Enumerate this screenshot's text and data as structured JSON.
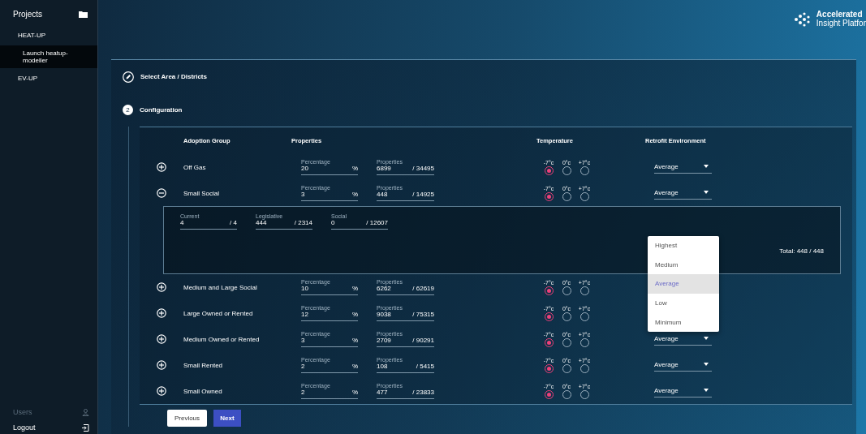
{
  "sidebar": {
    "title": "Projects",
    "items": [
      {
        "label": "HEAT-UP",
        "selected": false,
        "children": [
          {
            "label": "Launch heatup-modeller",
            "selected": true
          }
        ]
      },
      {
        "label": "EV-UP",
        "selected": false
      }
    ],
    "footer": [
      {
        "label": "Users",
        "disabled": true,
        "kind": "users"
      },
      {
        "label": "Logout",
        "disabled": false,
        "kind": "logout"
      }
    ]
  },
  "logo": {
    "line1": "Accelerated",
    "line2": "Insight Platfor"
  },
  "steps": [
    {
      "label": "Select Area / Districts",
      "kind": "done"
    },
    {
      "label": "Configuration",
      "kind": "active",
      "number": "2"
    }
  ],
  "table": {
    "columns": [
      "Adoption Group",
      "Properties",
      "Temperature",
      "Retrofit Environment"
    ],
    "rows": [
      {
        "name": "Off Gas",
        "expanded": false,
        "percentage_label": "Percentage",
        "percentage": "20",
        "unit": "%",
        "properties_label": "Properties",
        "properties": "6899",
        "properties_total": "/ 34495",
        "temperatures": [
          {
            "label": "-7°c",
            "selected": true
          },
          {
            "label": "0°c",
            "selected": false
          },
          {
            "label": "+7°c",
            "selected": false
          }
        ],
        "retrofit": "Average"
      },
      {
        "name": "Small Social",
        "expanded": true,
        "percentage_label": "Percentage",
        "percentage": "3",
        "unit": "%",
        "properties_label": "Properties",
        "properties": "448",
        "properties_total": "/ 14925",
        "temperatures": [
          {
            "label": "-7°c",
            "selected": true
          },
          {
            "label": "0°c",
            "selected": false
          },
          {
            "label": "+7°c",
            "selected": false
          }
        ],
        "retrofit": "Average",
        "details": {
          "fields": [
            {
              "label": "Current",
              "value": "4",
              "total": "/ 4"
            },
            {
              "label": "Legislative",
              "value": "444",
              "total": "/ 2314"
            },
            {
              "label": "Social",
              "value": "0",
              "total": "/ 12607"
            }
          ],
          "total": "Total: 448 / 448"
        }
      },
      {
        "name": "Medium and Large Social",
        "expanded": false,
        "percentage_label": "Percentage",
        "percentage": "10",
        "unit": "%",
        "properties_label": "Properties",
        "properties": "6262",
        "properties_total": "/ 62619",
        "temperatures": [
          {
            "label": "-7°c",
            "selected": true
          },
          {
            "label": "0°c",
            "selected": false
          },
          {
            "label": "+7°c",
            "selected": false
          }
        ]
      },
      {
        "name": "Large Owned or Rented",
        "expanded": false,
        "percentage_label": "Percentage",
        "percentage": "12",
        "unit": "%",
        "properties_label": "Properties",
        "properties": "9038",
        "properties_total": "/ 75315",
        "temperatures": [
          {
            "label": "-7°c",
            "selected": true
          },
          {
            "label": "0°c",
            "selected": false
          },
          {
            "label": "+7°c",
            "selected": false
          }
        ]
      },
      {
        "name": "Medium Owned or Rented",
        "expanded": false,
        "percentage_label": "Percentage",
        "percentage": "3",
        "unit": "%",
        "properties_label": "Properties",
        "properties": "2709",
        "properties_total": "/ 90291",
        "temperatures": [
          {
            "label": "-7°c",
            "selected": true
          },
          {
            "label": "0°c",
            "selected": false
          },
          {
            "label": "+7°c",
            "selected": false
          }
        ],
        "retrofit": "Average"
      },
      {
        "name": "Small Rented",
        "expanded": false,
        "percentage_label": "Percentage",
        "percentage": "2",
        "unit": "%",
        "properties_label": "Properties",
        "properties": "108",
        "properties_total": "/ 5415",
        "temperatures": [
          {
            "label": "-7°c",
            "selected": true
          },
          {
            "label": "0°c",
            "selected": false
          },
          {
            "label": "+7°c",
            "selected": false
          }
        ],
        "retrofit": "Average"
      },
      {
        "name": "Small Owned",
        "expanded": false,
        "percentage_label": "Percentage",
        "percentage": "2",
        "unit": "%",
        "properties_label": "Properties",
        "properties": "477",
        "properties_total": "/ 23833",
        "temperatures": [
          {
            "label": "-7°c",
            "selected": true
          },
          {
            "label": "0°c",
            "selected": false
          },
          {
            "label": "+7°c",
            "selected": false
          }
        ],
        "retrofit": "Average"
      }
    ]
  },
  "dropdown_menu": {
    "options": [
      {
        "label": "Highest",
        "selected": false
      },
      {
        "label": "Medium",
        "selected": false
      },
      {
        "label": "Average",
        "selected": true
      },
      {
        "label": "Low",
        "selected": false
      },
      {
        "label": "Minimum",
        "selected": false
      }
    ]
  },
  "buttons": [
    {
      "label": "Previous",
      "kind": "secondary"
    },
    {
      "label": "Next",
      "kind": "primary"
    }
  ]
}
